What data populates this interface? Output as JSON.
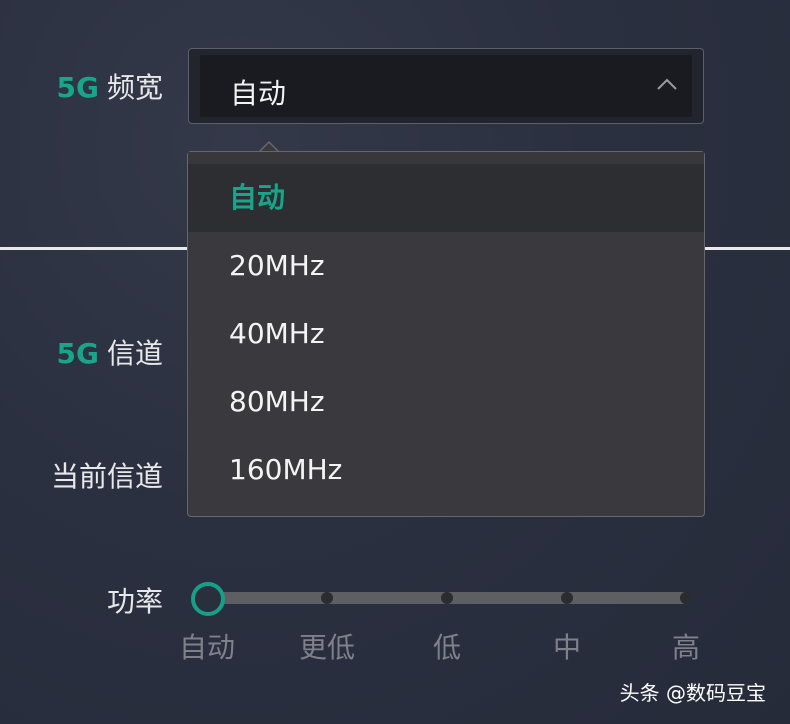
{
  "bandwidth": {
    "label_prefix": "5G",
    "label_text": "频宽",
    "selected_value": "自动"
  },
  "dropdown": {
    "options": [
      "自动",
      "20MHz",
      "40MHz",
      "80MHz",
      "160MHz"
    ],
    "selected_index": 0
  },
  "channel": {
    "label_prefix": "5G",
    "label_text": "信道"
  },
  "current_channel": {
    "label": "当前信道"
  },
  "power": {
    "label": "功率",
    "levels": [
      "自动",
      "更低",
      "低",
      "中",
      "高"
    ],
    "selected_level": "自动"
  },
  "watermark": "头条 @数码豆宝",
  "colors": {
    "accent": "#18a58a",
    "dropdown_bg": "#3a3a3e",
    "background": "#2b3040"
  },
  "icons": {
    "select_chevron": "chevron-up-icon"
  }
}
